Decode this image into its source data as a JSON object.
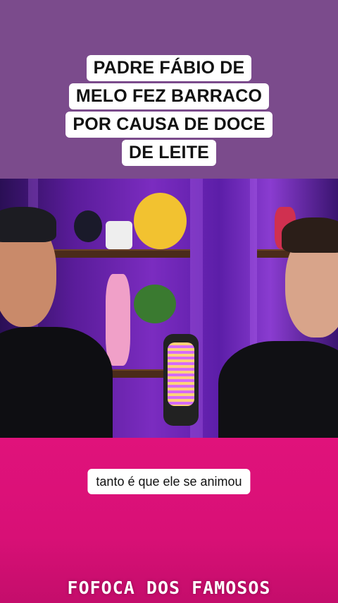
{
  "headline": {
    "lines": [
      "PADRE FÁBIO DE",
      "MELO FEZ BARRACO",
      "POR CAUSA DE DOCE",
      "DE LEITE"
    ]
  },
  "caption": "tanto é que ele se animou",
  "brand": "FOFOCA DOS FAMOSOS",
  "colors": {
    "top_band": "#7b4b8c",
    "bottom_band": "#e0127b",
    "caption_bg": "#ffffff"
  }
}
